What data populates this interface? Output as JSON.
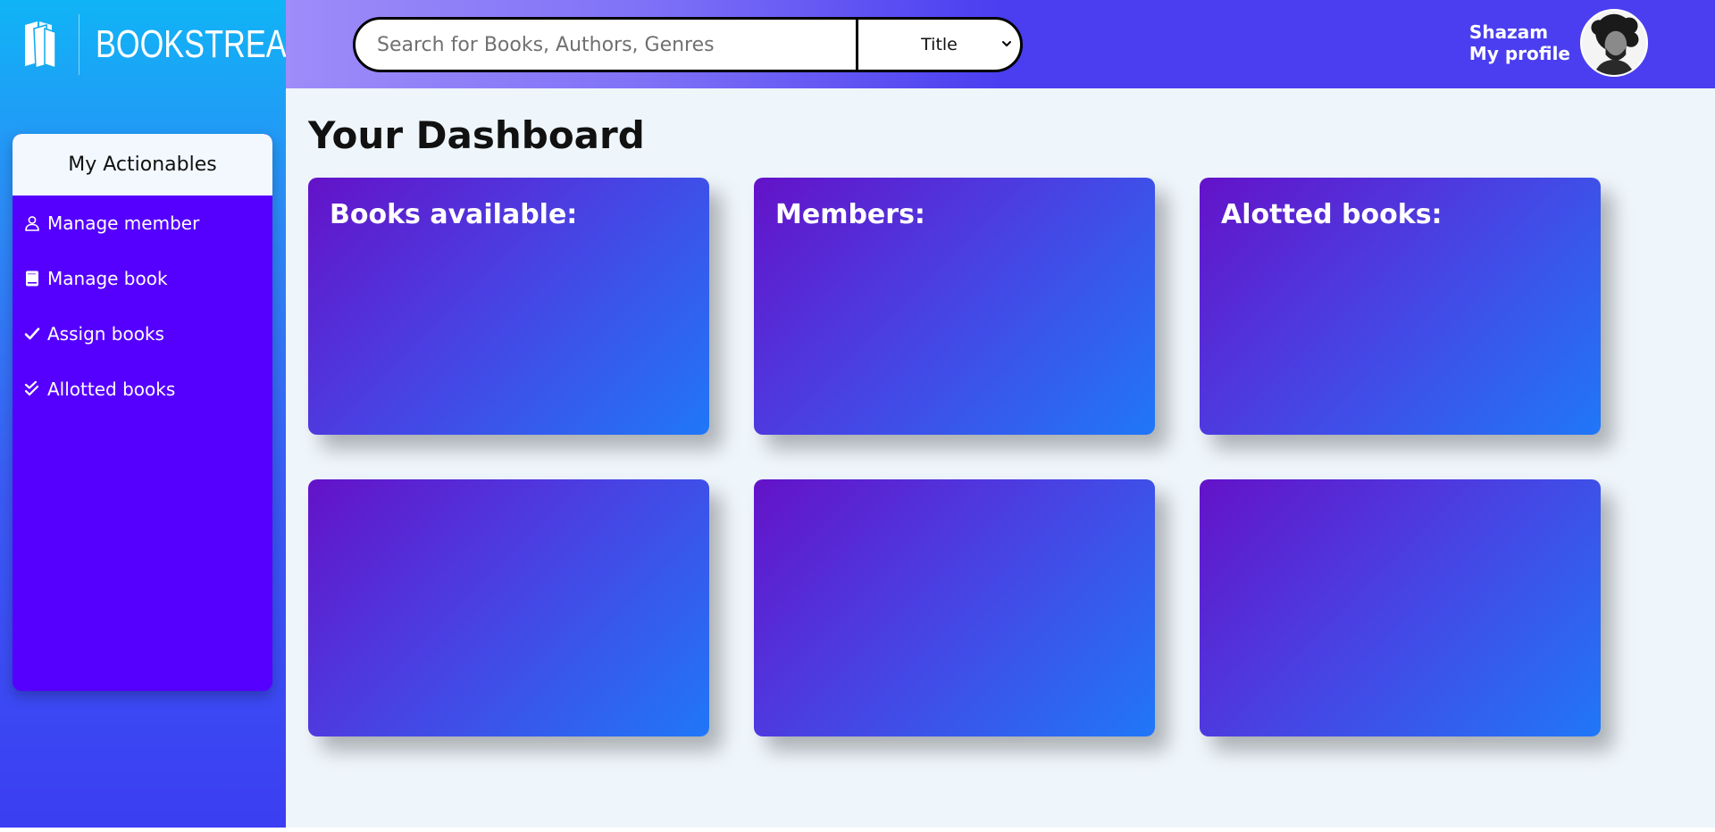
{
  "brand": {
    "name": "BOOKSTREAM"
  },
  "search": {
    "placeholder": "Search for Books, Authors, Genres",
    "filter_value": "Title"
  },
  "user": {
    "name": "Shazam",
    "profile_link": "My profile"
  },
  "sidebar": {
    "header": "My Actionables",
    "items": [
      {
        "label": "Manage member",
        "icon": "user-icon"
      },
      {
        "label": "Manage book",
        "icon": "book-icon"
      },
      {
        "label": "Assign books",
        "icon": "check-icon"
      },
      {
        "label": "Allotted books",
        "icon": "double-check-icon"
      }
    ]
  },
  "main": {
    "title": "Your Dashboard",
    "cards": [
      {
        "title": "Books available:"
      },
      {
        "title": "Members:"
      },
      {
        "title": "Alotted books:"
      },
      {
        "title": ""
      },
      {
        "title": ""
      },
      {
        "title": ""
      }
    ]
  },
  "colors": {
    "sidebar_bg": "#5500ff",
    "card_gradient_start": "#6412c8",
    "card_gradient_end": "#2077f7",
    "header_accent": "#4a3ef0"
  }
}
